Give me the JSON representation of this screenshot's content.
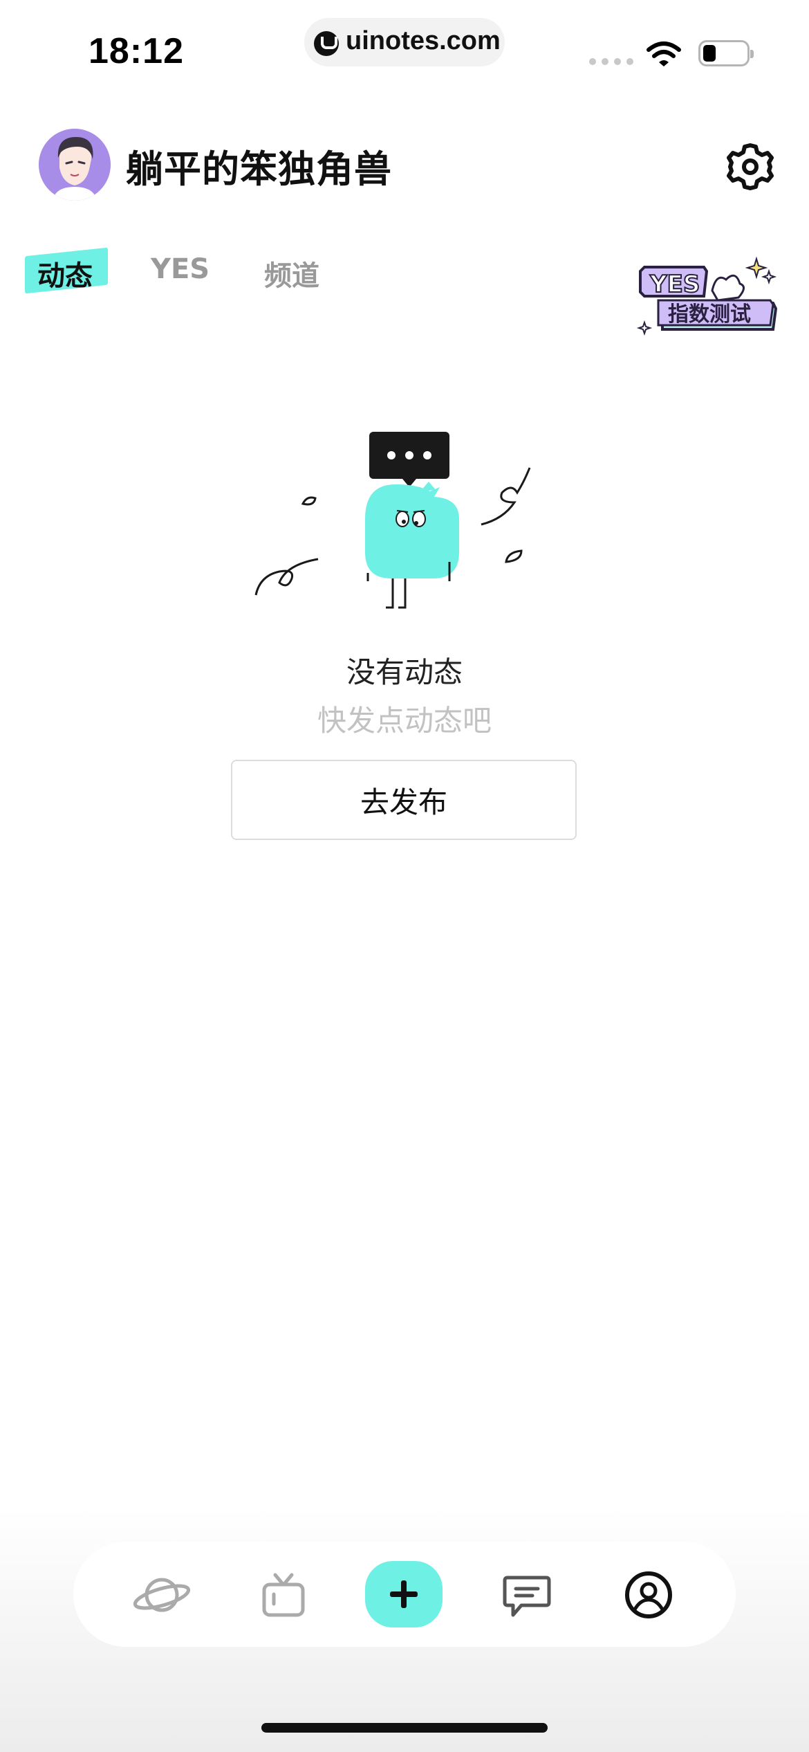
{
  "status_bar": {
    "time": "18:12",
    "url": "uinotes.com"
  },
  "profile": {
    "username": "躺平的笨独角兽",
    "avatar_icon": "avatar-illustration",
    "settings_icon": "gear-icon"
  },
  "tabs": [
    {
      "label": "动态",
      "active": true
    },
    {
      "label": "YES",
      "active": false
    },
    {
      "label": "频道",
      "active": false
    }
  ],
  "yes_badge": {
    "line1": "YES",
    "line2": "指数测试"
  },
  "empty_state": {
    "title": "没有动态",
    "subtitle": "快发点动态吧",
    "button_label": "去发布"
  },
  "bottom_nav": [
    {
      "icon": "planet-icon"
    },
    {
      "icon": "tv-icon"
    },
    {
      "icon": "plus-icon"
    },
    {
      "icon": "message-icon"
    },
    {
      "icon": "profile-icon",
      "active": true
    }
  ],
  "colors": {
    "accent": "#6ff0e4",
    "avatar_bg": "#a88de8",
    "text_primary": "#111111",
    "text_muted": "#999999"
  }
}
